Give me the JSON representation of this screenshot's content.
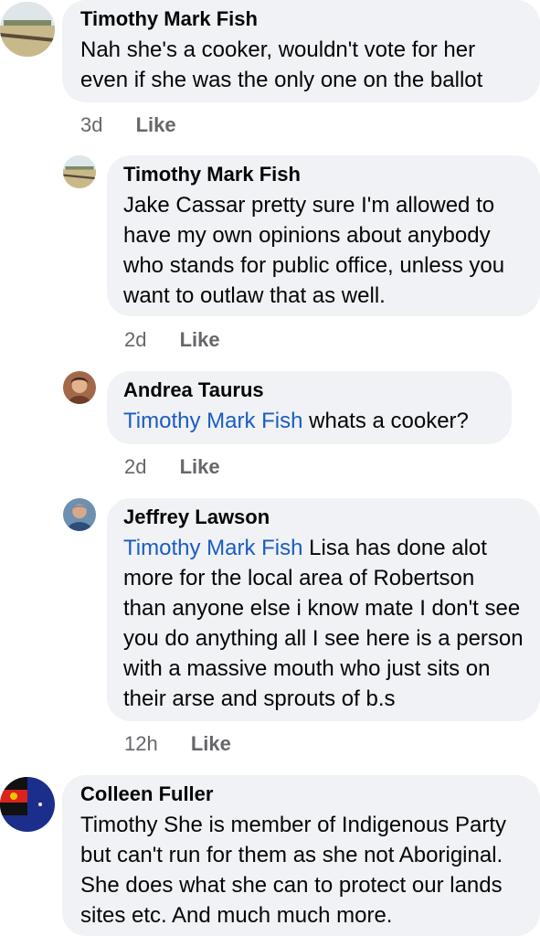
{
  "comments": [
    {
      "author": "Timothy Mark Fish",
      "text": "Nah she's a cooker, wouldn't vote for her\neven if she was the only one on the ballot",
      "time": "3d",
      "like": "Like"
    },
    {
      "author": "Timothy Mark Fish",
      "text": "Jake Cassar pretty sure I'm allowed to\nhave my own opinions about anybody\nwho stands for public office, unless you\nwant to outlaw that as well.",
      "time": "2d",
      "like": "Like"
    },
    {
      "author": "Andrea Taurus",
      "mention": "Timothy Mark Fish",
      "text": " whats a cooker?",
      "time": "2d",
      "like": "Like"
    },
    {
      "author": "Jeffrey Lawson",
      "mention": "Timothy Mark Fish",
      "text": " Lisa has done alot\nmore for the local area of Robertson\nthan anyone else i know mate I don't see\nyou do anything all I see here is a person\nwith a massive mouth who just sits on\ntheir arse and sprouts of b.s",
      "time": "12h",
      "like": "Like"
    },
    {
      "author": "Colleen Fuller",
      "text": "Timothy She is member of Indigenous Party\nbut can't run for them as she not Aboriginal.\nShe does what she can to protect our lands\nsites etc. And much much more."
    }
  ],
  "colors": {
    "bubble": "#f0f2f5",
    "mention": "#1a5cc4",
    "meta": "#65676b"
  },
  "icons": [
    "landscape-avatar-icon",
    "portrait-avatar-icon",
    "flag-avatar-icon"
  ]
}
